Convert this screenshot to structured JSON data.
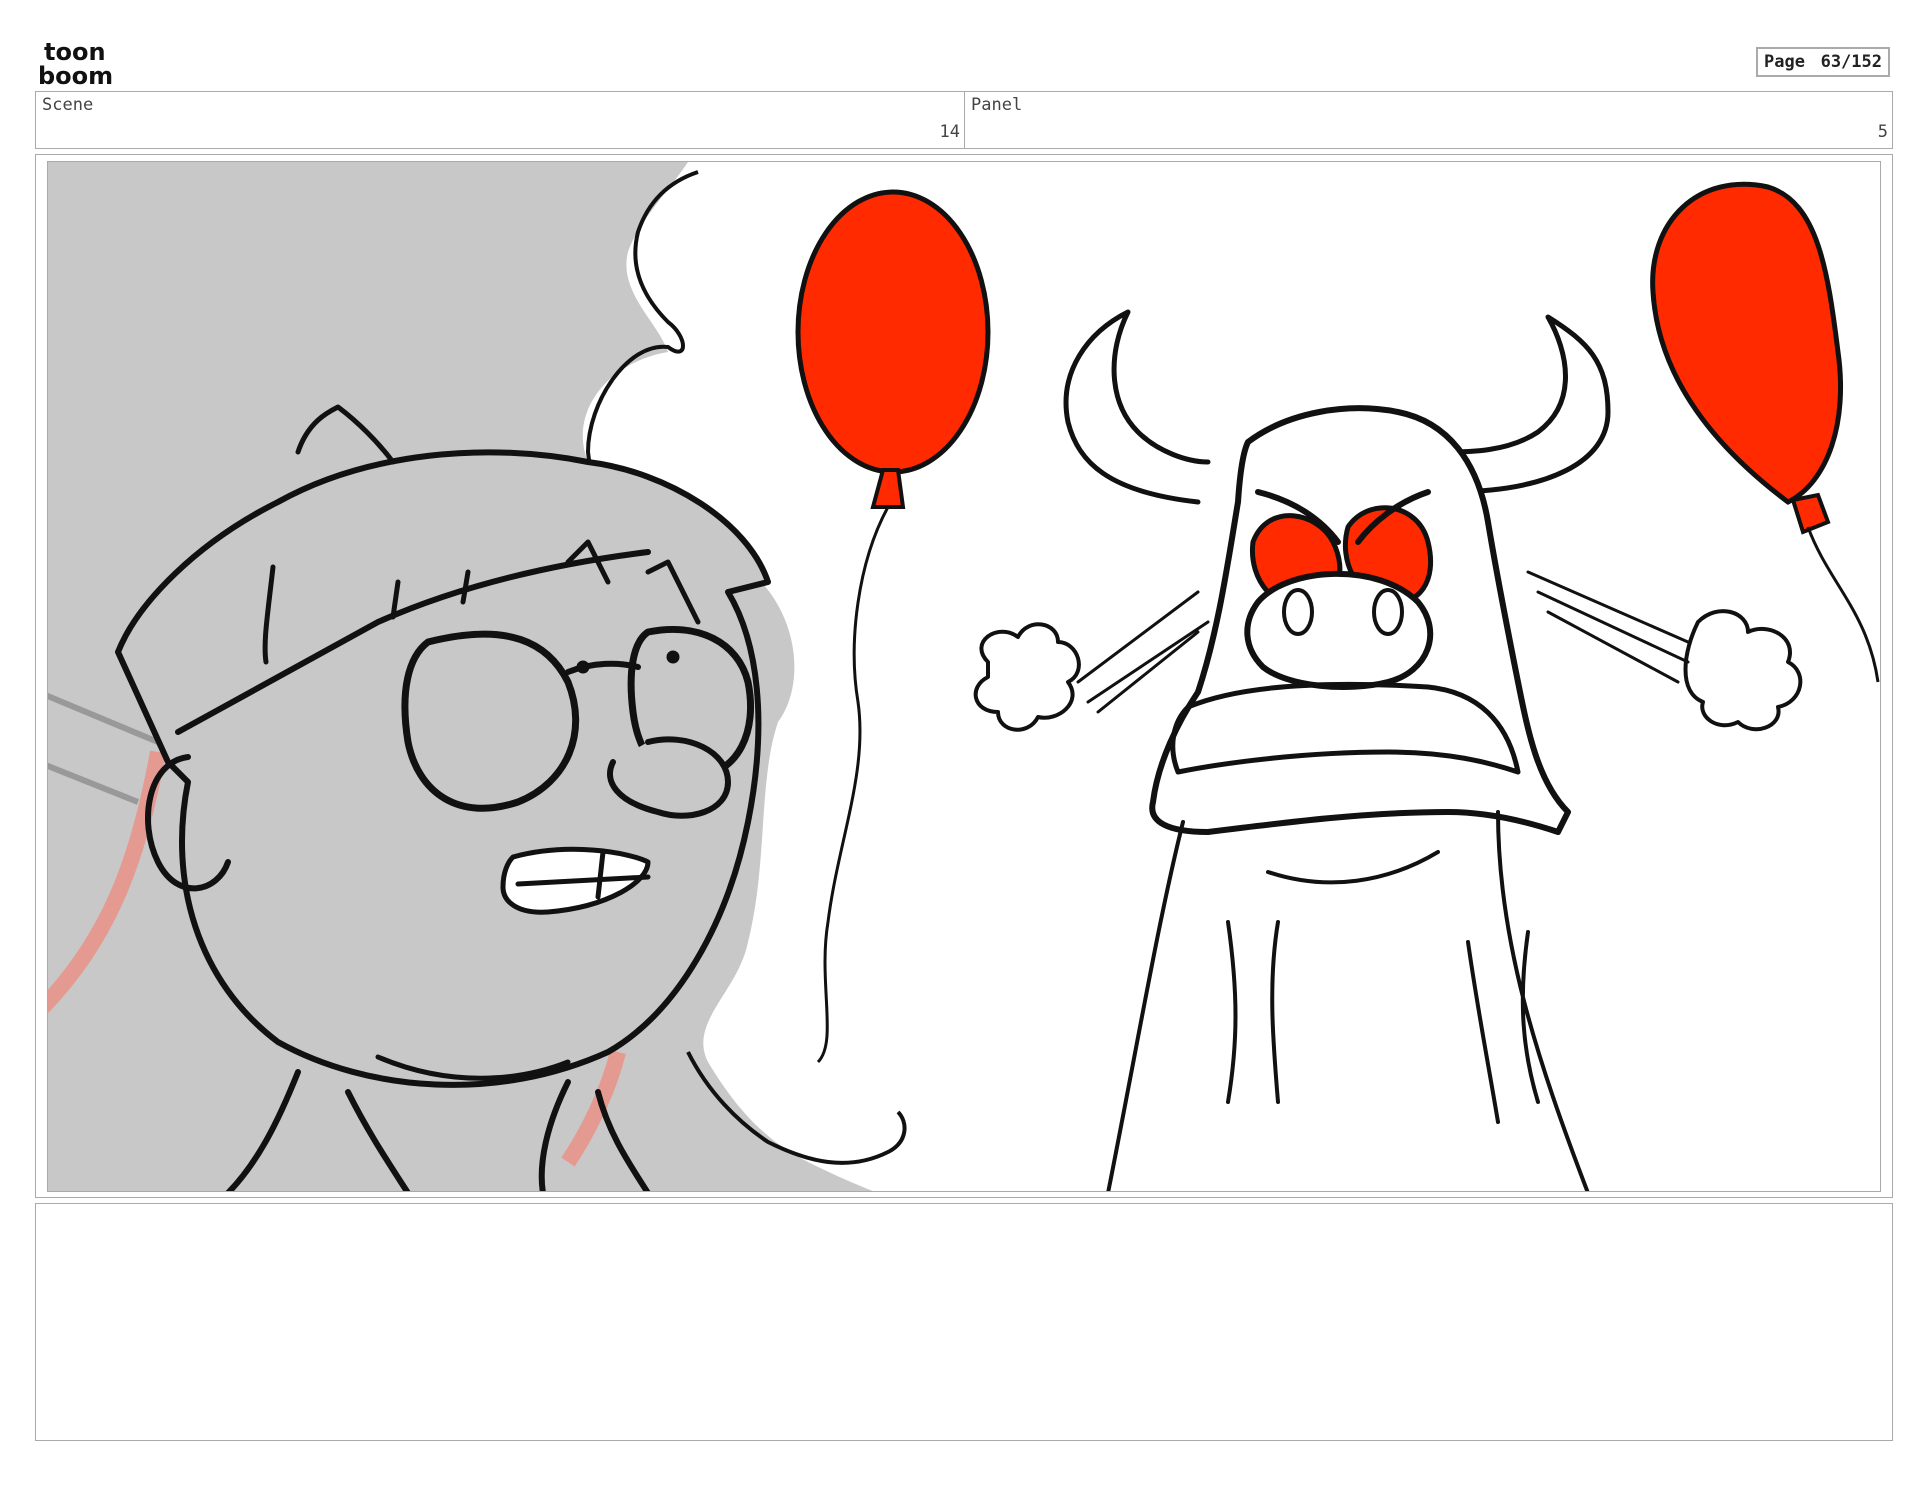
{
  "brand": {
    "logo_text_top": "toon",
    "logo_text_bottom": "boom"
  },
  "page": {
    "label": "Page",
    "value": "63/152"
  },
  "header": {
    "scene_label": "Scene",
    "scene_value": "14",
    "panel_label": "Panel",
    "panel_value": "5"
  },
  "notes": {
    "text": ""
  },
  "colors": {
    "balloon_red": "#ff2a00",
    "boy_gray": "#c8c8c8",
    "border_gray": "#aaaaaa"
  },
  "artwork": {
    "characters": [
      "boy-with-glasses",
      "angry-bull"
    ],
    "props": [
      "red-balloon",
      "red-balloon"
    ]
  }
}
